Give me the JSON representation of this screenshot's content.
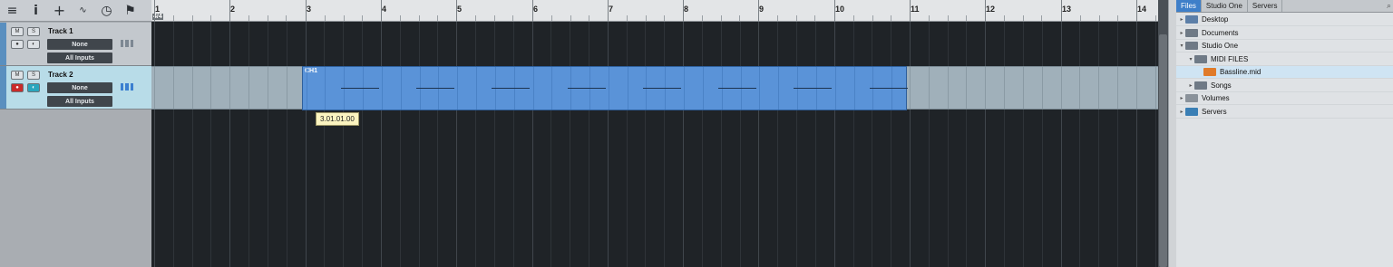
{
  "arrange": {
    "time_signature": "4/4",
    "bars": [
      "1",
      "2",
      "3",
      "4",
      "5",
      "6",
      "7",
      "8",
      "9",
      "10",
      "11",
      "12",
      "13",
      "14"
    ],
    "event_label": "CH1",
    "tooltip": "3.01.01.00"
  },
  "tracks": [
    {
      "name": "Track 1",
      "mute": "M",
      "solo": "S",
      "output": "None",
      "input": "All Inputs"
    },
    {
      "name": "Track 2",
      "mute": "M",
      "solo": "S",
      "output": "None",
      "input": "All Inputs"
    }
  ],
  "toolbar": {
    "icons": [
      "menu-icon",
      "info-icon",
      "add-track-icon",
      "automation-icon",
      "clock-icon",
      "flag-icon"
    ]
  },
  "browser": {
    "tabs": [
      "Files",
      "Studio One",
      "Servers"
    ],
    "active_tab": "Files",
    "items": [
      {
        "label": "Desktop",
        "icon": "desktop-icon"
      },
      {
        "label": "Documents",
        "icon": "folder-icon"
      },
      {
        "label": "Studio One",
        "icon": "folder-icon"
      },
      {
        "label": "MIDI FILES",
        "icon": "folder-icon"
      },
      {
        "label": "Bassline.mid",
        "icon": "midi-file-icon"
      },
      {
        "label": "Songs",
        "icon": "folder-icon"
      },
      {
        "label": "Volumes",
        "icon": "drive-icon"
      },
      {
        "label": "Servers",
        "icon": "globe-icon"
      }
    ]
  }
}
